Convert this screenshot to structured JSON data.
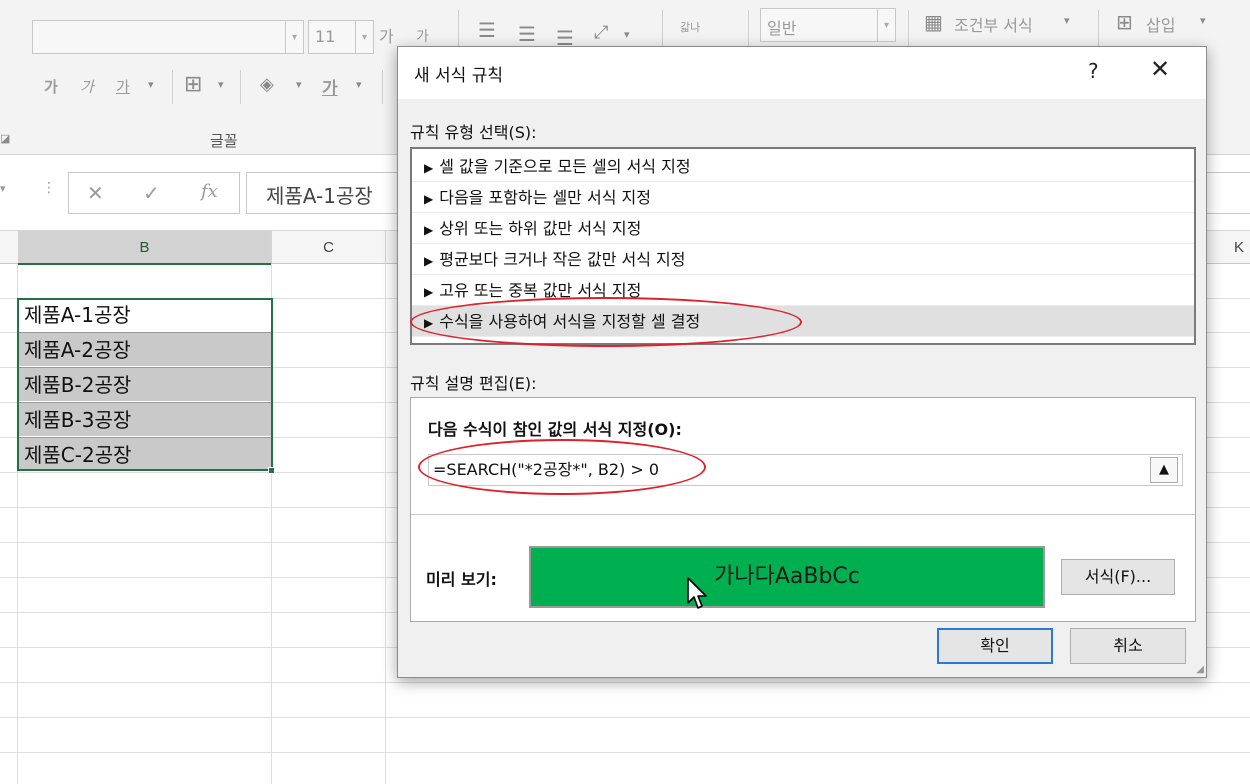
{
  "ribbon": {
    "font_size": "11",
    "grow_font": "가",
    "shrink_font": "가",
    "bold": "가",
    "italic": "가",
    "underline": "가",
    "font_color_letter": "가",
    "wrap_text": "갋나",
    "number_format": "일반",
    "conditional_format_label": "조건부 서식",
    "insert_label": "삽입",
    "font_group_label": "글꼴"
  },
  "formula_bar": {
    "cancel_symbol": "✕",
    "enter_symbol": "✓",
    "fx_symbol": "fx",
    "content": "제품A-1공장"
  },
  "grid": {
    "columns": [
      "B",
      "C",
      "K"
    ],
    "cells": [
      "제품A-1공장",
      "제품A-2공장",
      "제품B-2공장",
      "제품B-3공장",
      "제품C-2공장"
    ]
  },
  "dialog": {
    "title": "새 서식 규칙",
    "help": "?",
    "close": "✕",
    "rule_type_label": "규칙 유형 선택(S):",
    "rule_types": [
      "셀 값을 기준으로 모든 셀의 서식 지정",
      "다음을 포함하는 셀만 서식 지정",
      "상위 또는 하위 값만 서식 지정",
      "평균보다 크거나 작은 값만 서식 지정",
      "고유 또는 중복 값만 서식 지정",
      "수식을 사용하여 서식을 지정할 셀 결정"
    ],
    "selected_rule_index": 5,
    "description_label": "규칙 설명 편집(E):",
    "formula_label": "다음 수식이 참인 값의 서식 지정(O):",
    "formula_value": "=SEARCH(\"*2공장*\", B2) > 0",
    "preview_label": "미리 보기:",
    "preview_text": "가나다AaBbCc",
    "preview_color": "#00b050",
    "format_button": "서식(F)...",
    "ok_button": "확인",
    "cancel_button": "취소"
  }
}
